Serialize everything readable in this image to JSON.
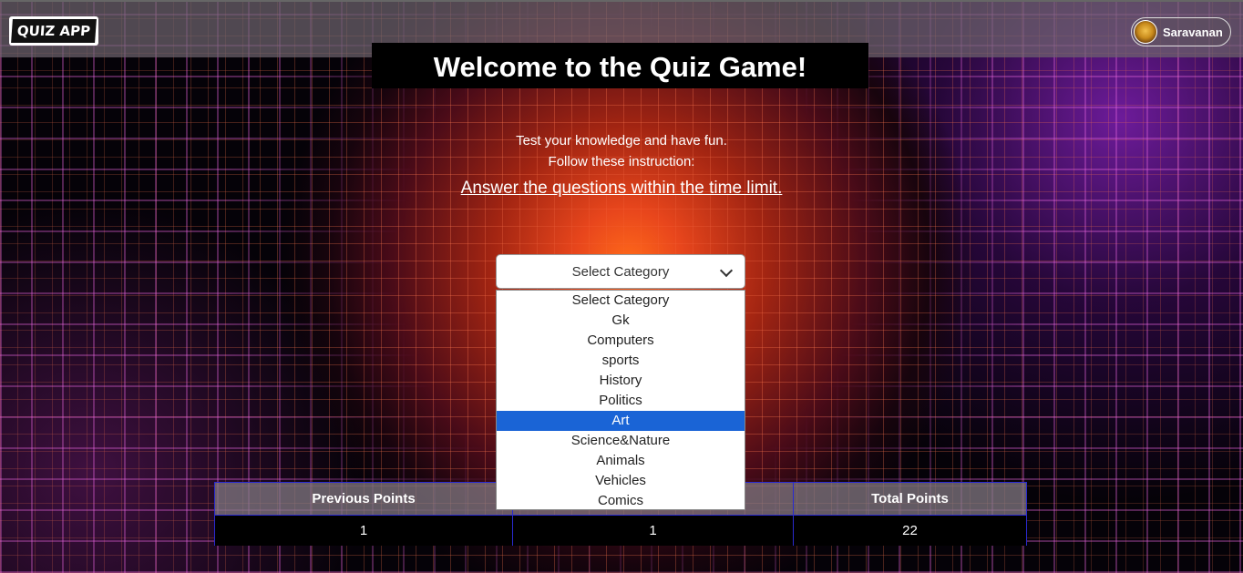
{
  "navbar": {
    "logo_text": "QUIZ APP",
    "user_name": "Saravanan"
  },
  "hero": {
    "title": "Welcome to the Quiz Game!",
    "line1": "Test your knowledge and have fun.",
    "line2": "Follow these instruction:",
    "line3": "Answer the questions within the time limit."
  },
  "category_select": {
    "selected_label": "Select Category",
    "highlighted": "Art",
    "options": [
      "Select Category",
      "Gk",
      "Computers",
      "sports",
      "History",
      "Politics",
      "Art",
      "Science&Nature",
      "Animals",
      "Vehicles",
      "Comics"
    ]
  },
  "points_table": {
    "headers": [
      "Previous Points",
      "",
      "Total Points"
    ],
    "values": [
      "1",
      "1",
      "22"
    ]
  },
  "colors": {
    "highlight": "#1a64d6",
    "table_border": "#2a2ad0"
  }
}
